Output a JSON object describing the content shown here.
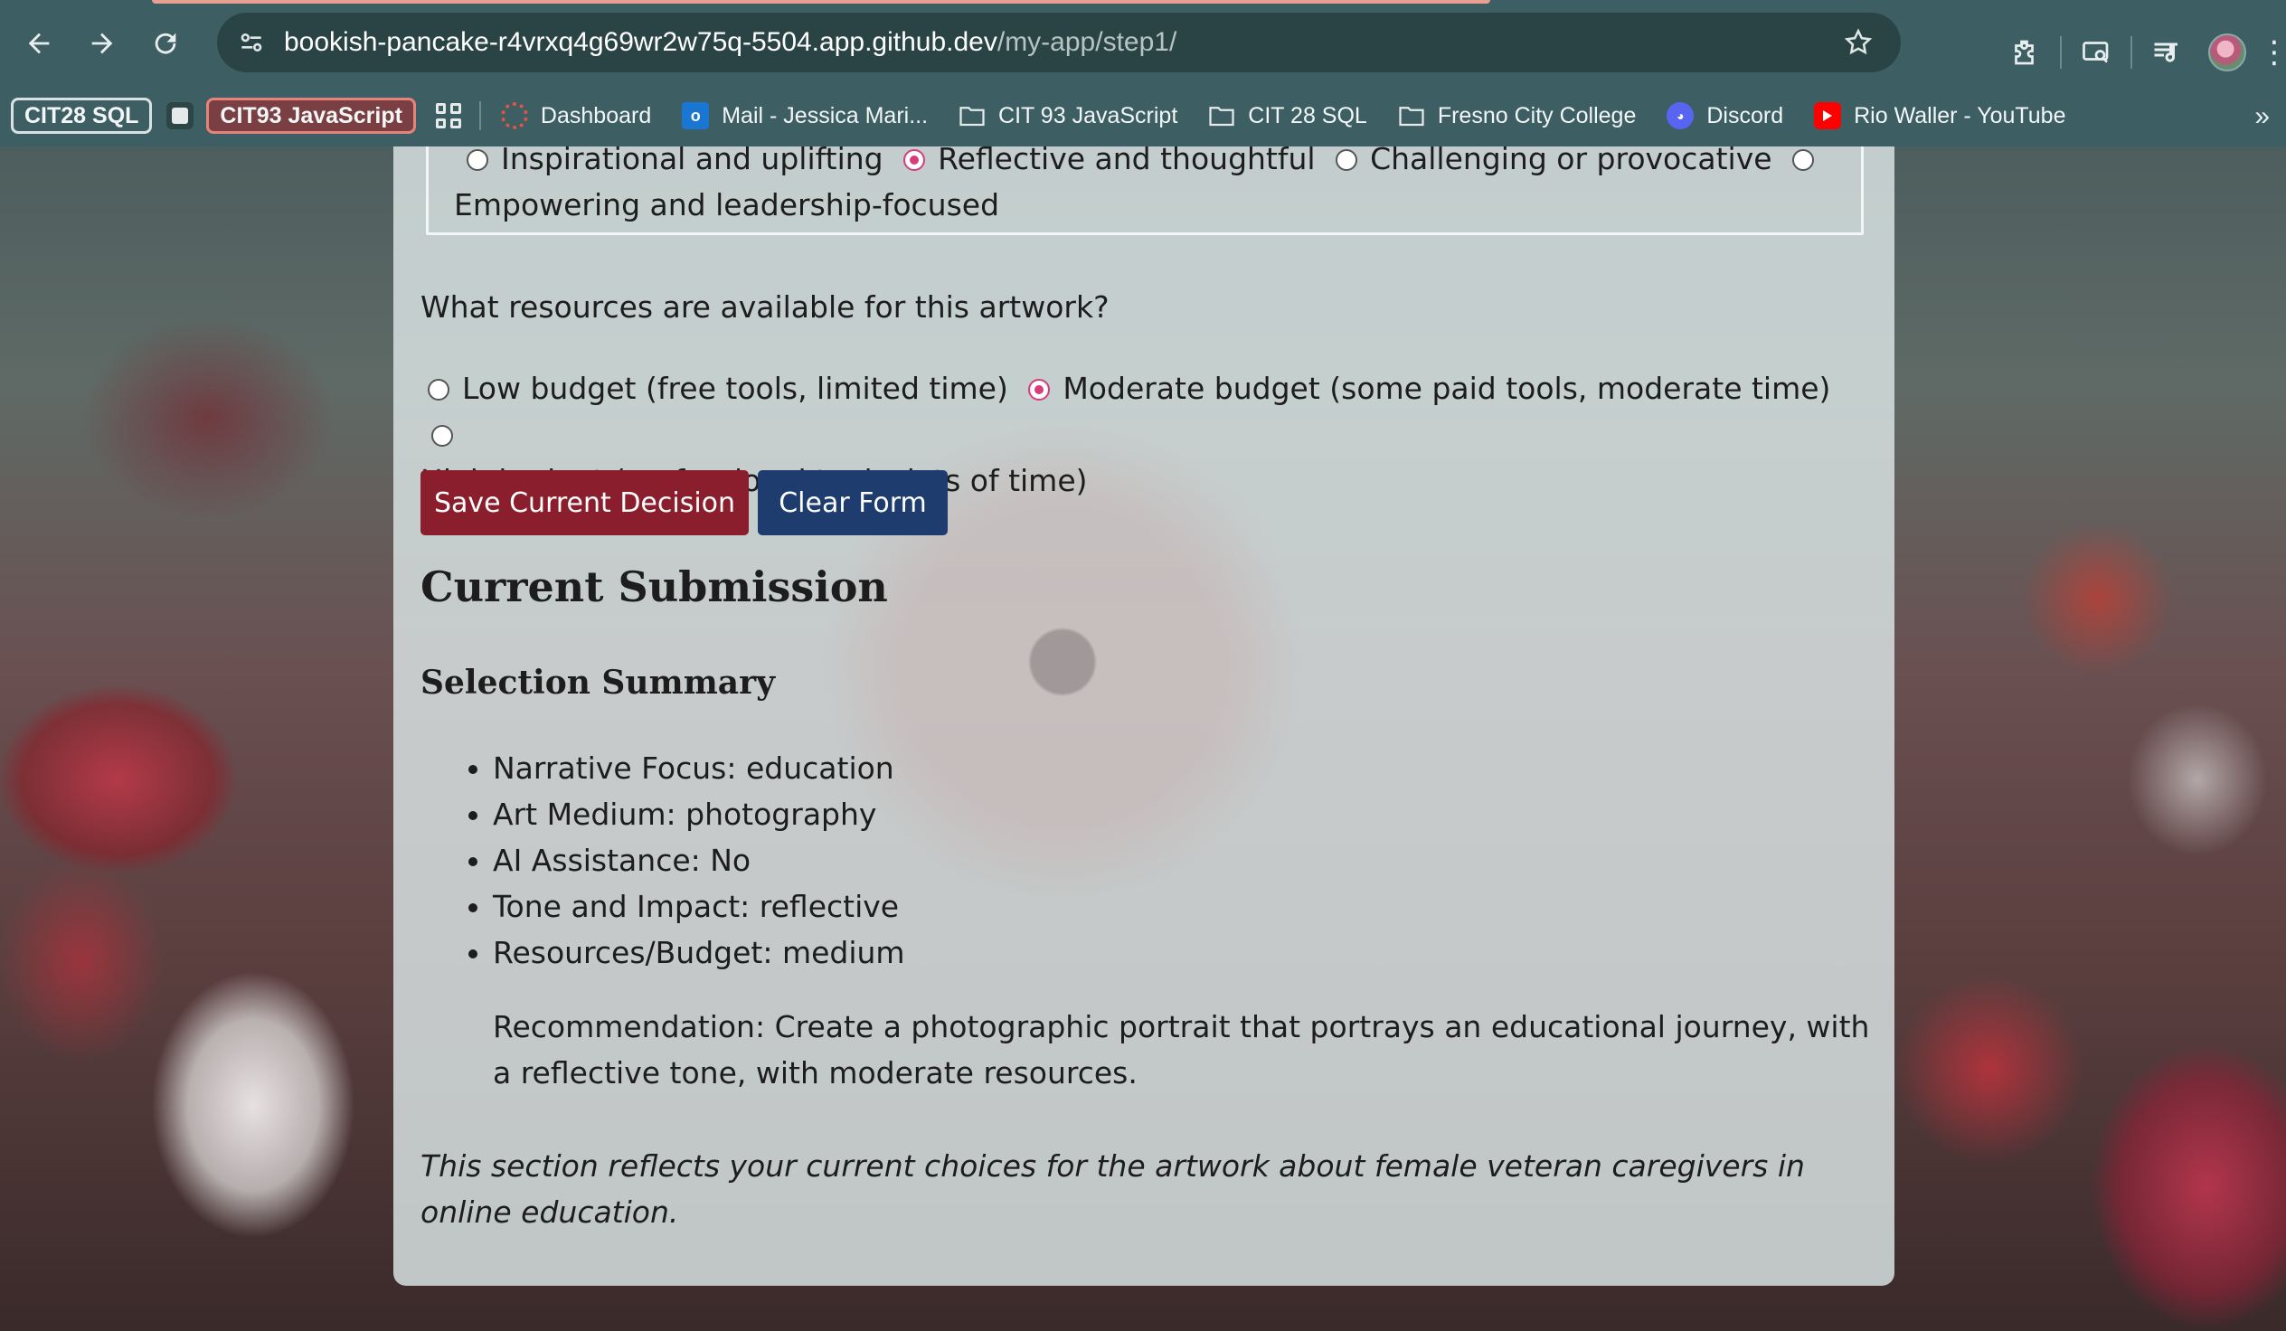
{
  "browser": {
    "url_host": "bookish-pancake-r4vrxq4g69wr2w75q-5504.app.github.dev",
    "url_path": "/my-app/step1/",
    "bookmarks": {
      "chip_sql": "CIT28 SQL",
      "chip_js": "CIT93 JavaScript",
      "items": [
        {
          "label": "Dashboard",
          "icon": "dashboard-icon"
        },
        {
          "label": "Mail - Jessica Mari...",
          "icon": "outlook-icon"
        },
        {
          "label": "CIT 93 JavaScript",
          "icon": "folder-icon"
        },
        {
          "label": "CIT 28 SQL",
          "icon": "folder-icon"
        },
        {
          "label": "Fresno City College",
          "icon": "folder-icon"
        },
        {
          "label": "Discord",
          "icon": "discord-icon"
        },
        {
          "label": "Rio Waller - YouTube",
          "icon": "youtube-icon"
        }
      ]
    }
  },
  "form": {
    "tone": {
      "options": [
        {
          "label": "Inspirational and uplifting",
          "checked": false
        },
        {
          "label": "Reflective and thoughtful",
          "checked": true
        },
        {
          "label": "Challenging or provocative",
          "checked": false
        },
        {
          "label": "Empowering and leadership-focused",
          "checked": false
        }
      ]
    },
    "resources": {
      "question": "What resources are available for this artwork?",
      "options": [
        {
          "label": "Low budget (free tools, limited time)",
          "checked": false
        },
        {
          "label": "Moderate budget (some paid tools, moderate time)",
          "checked": true
        },
        {
          "label": "High budget (professional tools, lots of time)",
          "checked": false
        }
      ]
    },
    "save_label": "Save Current Decision",
    "clear_label": "Clear Form"
  },
  "submission": {
    "title": "Current Submission",
    "summary_title": "Selection Summary",
    "items": [
      "Narrative Focus: education",
      "Art Medium: photography",
      "AI Assistance: No",
      "Tone and Impact: reflective",
      "Resources/Budget: medium"
    ],
    "recommendation": "Recommendation: Create a photographic portrait that portrays an educational journey, with a reflective tone, with moderate resources.",
    "note": "This section reflects your current choices for the artwork about female veteran caregivers in online education."
  },
  "colors": {
    "save_button": "#8a1e2c",
    "clear_button": "#1e3d6e",
    "radio_checked": "#d83d7b",
    "chrome": "#3d5f63"
  }
}
